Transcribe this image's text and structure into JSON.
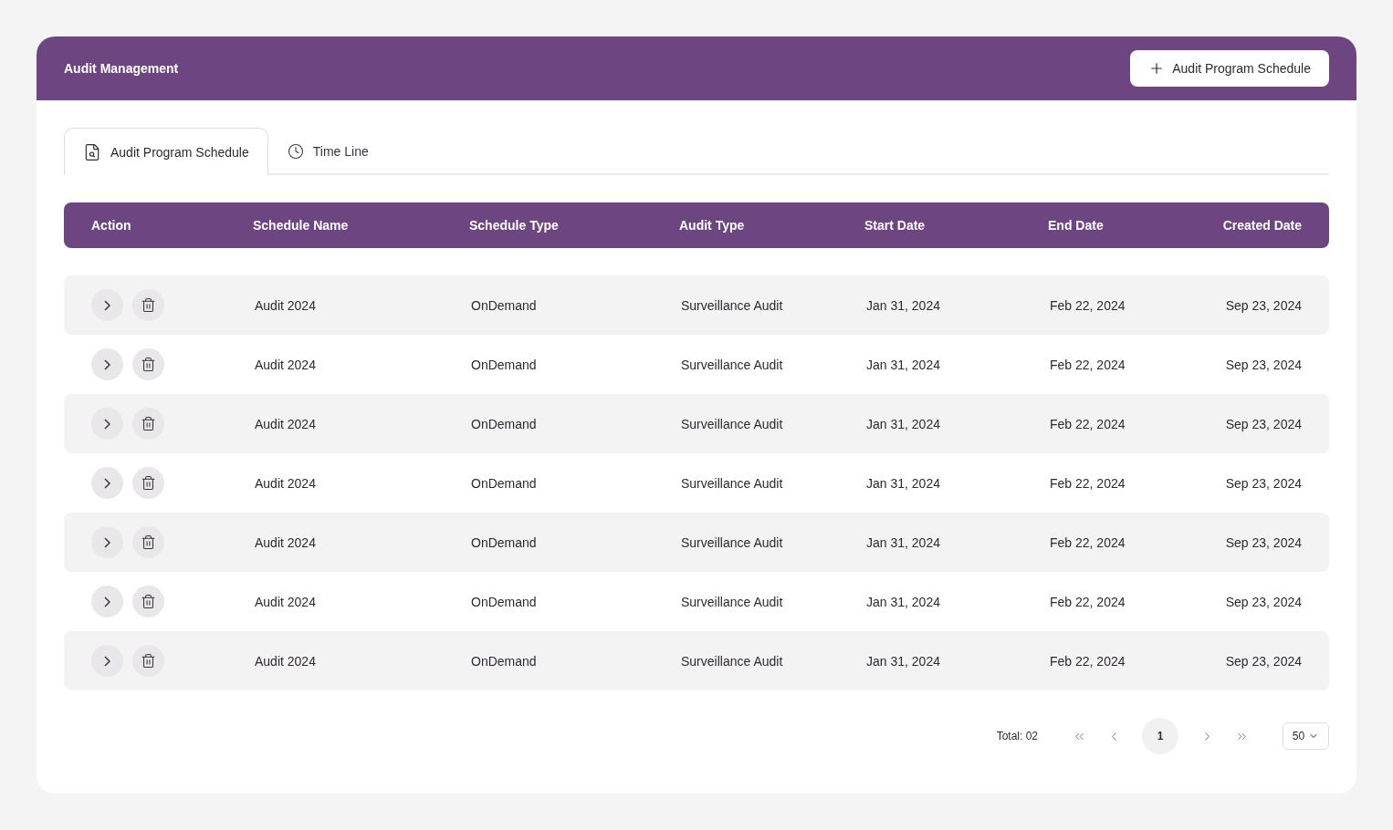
{
  "header": {
    "title": "Audit Management",
    "add_button": "Audit Program Schedule"
  },
  "tabs": [
    {
      "label": "Audit Program Schedule",
      "selected": true
    },
    {
      "label": "Time Line",
      "selected": false
    }
  ],
  "table": {
    "columns": [
      "Action",
      "Schedule Name",
      "Schedule Type",
      "Audit Type",
      "Start Date",
      "End Date",
      "Created Date"
    ],
    "rows": [
      {
        "name": "Audit 2024",
        "schedule_type": "OnDemand",
        "audit_type": "Surveillance Audit",
        "start": "Jan 31, 2024",
        "end": "Feb 22, 2024",
        "created": "Sep 23, 2024"
      },
      {
        "name": "Audit 2024",
        "schedule_type": "OnDemand",
        "audit_type": "Surveillance Audit",
        "start": "Jan 31, 2024",
        "end": "Feb 22, 2024",
        "created": "Sep 23, 2024"
      },
      {
        "name": "Audit 2024",
        "schedule_type": "OnDemand",
        "audit_type": "Surveillance Audit",
        "start": "Jan 31, 2024",
        "end": "Feb 22, 2024",
        "created": "Sep 23, 2024"
      },
      {
        "name": "Audit 2024",
        "schedule_type": "OnDemand",
        "audit_type": "Surveillance Audit",
        "start": "Jan 31, 2024",
        "end": "Feb 22, 2024",
        "created": "Sep 23, 2024"
      },
      {
        "name": "Audit 2024",
        "schedule_type": "OnDemand",
        "audit_type": "Surveillance Audit",
        "start": "Jan 31, 2024",
        "end": "Feb 22, 2024",
        "created": "Sep 23, 2024"
      },
      {
        "name": "Audit 2024",
        "schedule_type": "OnDemand",
        "audit_type": "Surveillance Audit",
        "start": "Jan 31, 2024",
        "end": "Feb 22, 2024",
        "created": "Sep 23, 2024"
      },
      {
        "name": "Audit 2024",
        "schedule_type": "OnDemand",
        "audit_type": "Surveillance Audit",
        "start": "Jan 31, 2024",
        "end": "Feb 22, 2024",
        "created": "Sep 23, 2024"
      }
    ]
  },
  "pagination": {
    "total": "Total: 02",
    "pages": [
      {
        "label": "1",
        "selected": true
      }
    ],
    "page_size": "50"
  }
}
